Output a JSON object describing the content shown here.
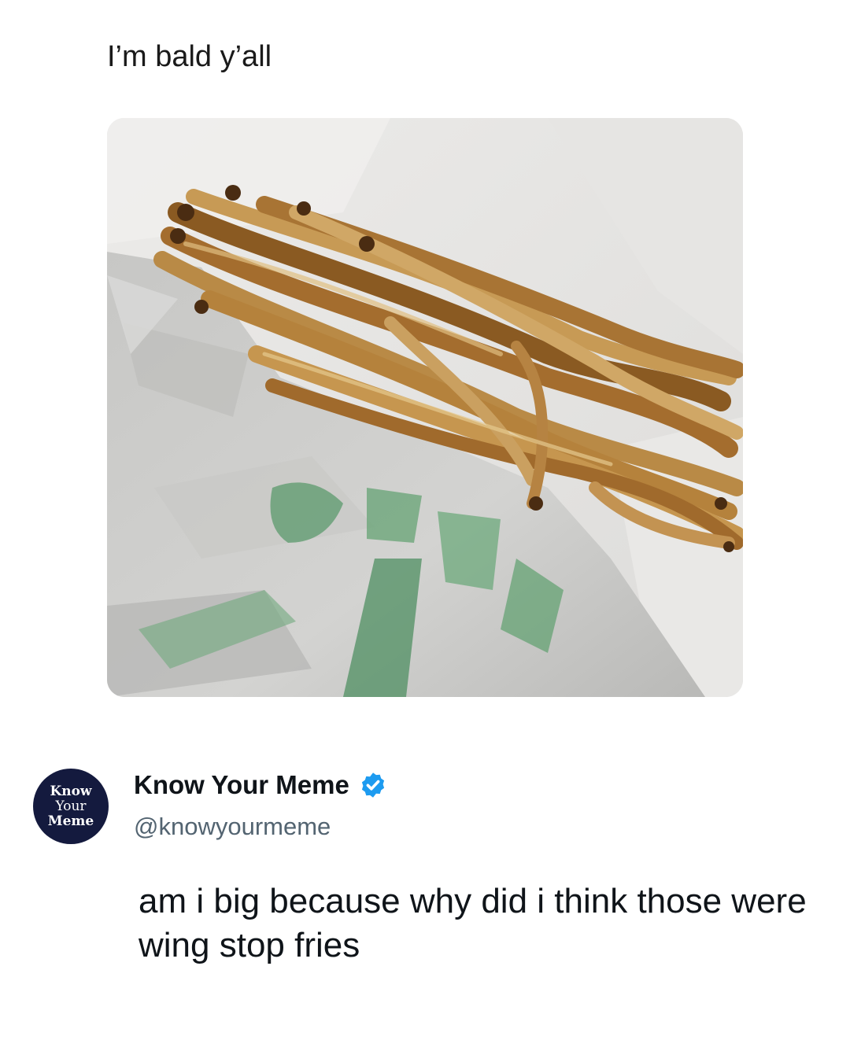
{
  "quoted_post": {
    "text": "I’m bald y’all"
  },
  "author": {
    "avatar_lines": [
      "Know",
      "Your",
      "Meme"
    ],
    "display_name": "Know Your Meme",
    "handle": "@knowyourmeme",
    "verified": true
  },
  "post": {
    "text": "am i big because why did i think those were wing stop fries"
  },
  "colors": {
    "verified_badge": "#1d9bf0",
    "avatar_background": "#141a3e",
    "handle_gray": "#536471"
  }
}
